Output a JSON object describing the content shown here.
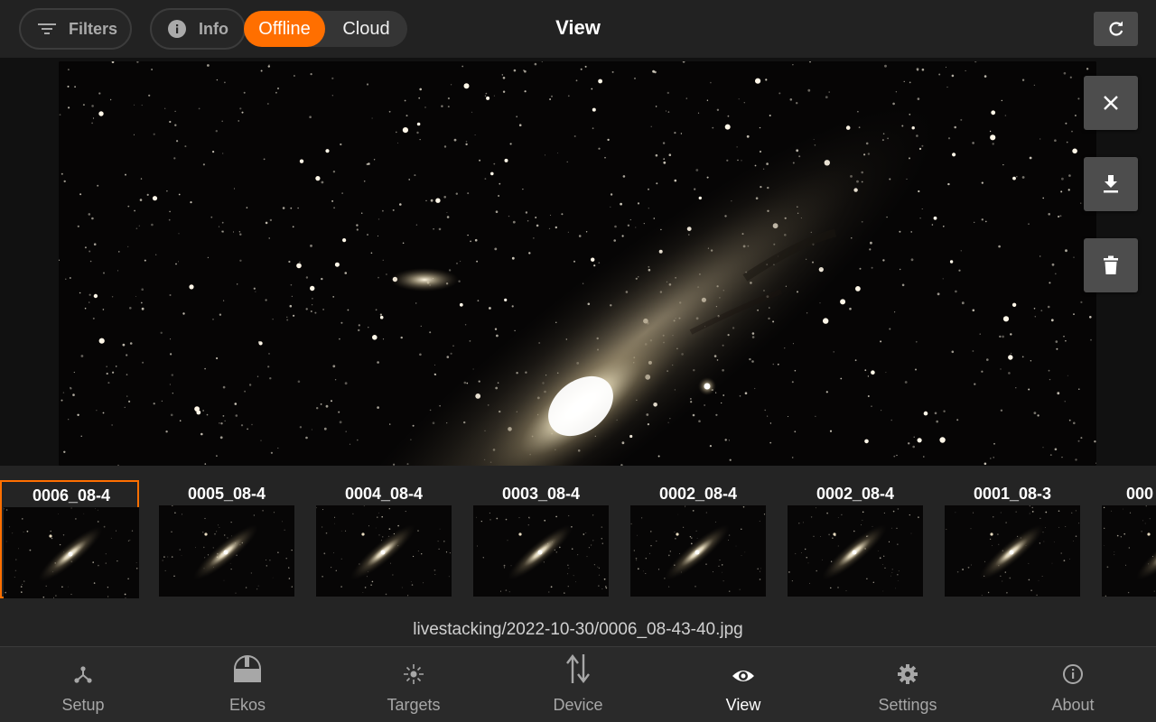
{
  "header": {
    "filters_label": "Filters",
    "info_label": "Info",
    "segment": {
      "offline_label": "Offline",
      "cloud_label": "Cloud",
      "selected": "Offline"
    },
    "title": "View"
  },
  "thumbnails": [
    {
      "label": "0006_08-4",
      "selected": true
    },
    {
      "label": "0005_08-4",
      "selected": false
    },
    {
      "label": "0004_08-4",
      "selected": false
    },
    {
      "label": "0003_08-4",
      "selected": false
    },
    {
      "label": "0002_08-4",
      "selected": false
    },
    {
      "label": "0002_08-4",
      "selected": false
    },
    {
      "label": "0001_08-3",
      "selected": false
    },
    {
      "label": "000",
      "selected": false
    }
  ],
  "file_path": "livestacking/2022-10-30/0006_08-43-40.jpg",
  "nav": [
    {
      "label": "Setup",
      "icon": "setup-icon",
      "active": false
    },
    {
      "label": "Ekos",
      "icon": "ekos-dome-icon",
      "active": false
    },
    {
      "label": "Targets",
      "icon": "targets-icon",
      "active": false
    },
    {
      "label": "Device",
      "icon": "device-icon",
      "active": false
    },
    {
      "label": "View",
      "icon": "eye-icon",
      "active": true
    },
    {
      "label": "Settings",
      "icon": "gear-icon",
      "active": false
    },
    {
      "label": "About",
      "icon": "info-icon",
      "active": false
    }
  ],
  "colors": {
    "accent": "#ff6f00",
    "background": "#222222"
  }
}
